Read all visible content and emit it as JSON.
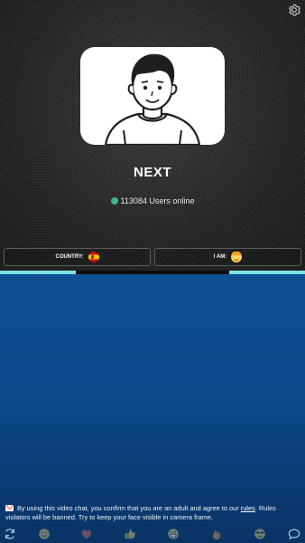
{
  "header": {
    "settings_icon": "gear-icon"
  },
  "main": {
    "avatar_icon": "user-avatar-illustration",
    "next_label": "NEXT",
    "online": {
      "count": "113084",
      "suffix": " Users online",
      "status_color": "#3fb58f"
    }
  },
  "filters": {
    "country_label": "COUNTRY:",
    "country_flag": "spain-flag-icon",
    "iam_label": "I AM:",
    "iam_icon": "male-face-icon"
  },
  "notice": {
    "icon": "mail-icon",
    "text_before": "By using this video chat, you confirm that you are an adult and agree to our ",
    "link": "rules",
    "text_after": ". Rules violators will be banned. Try to keep your face visible in camera frame."
  },
  "toolbar": {
    "icons": [
      "refresh-icon",
      "smile-icon",
      "heart-icon",
      "thumbs-up-icon",
      "grin-icon",
      "fire-icon",
      "cool-face-icon",
      "chat-icon"
    ]
  },
  "colors": {
    "accent_line": "#7ee0e6",
    "bottom_bg": "#0d4a8c"
  }
}
